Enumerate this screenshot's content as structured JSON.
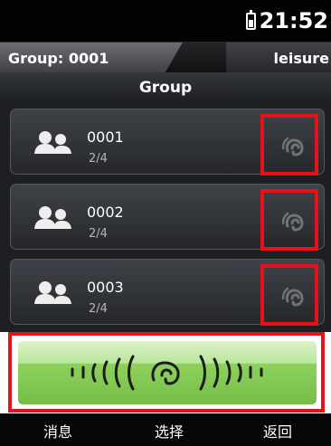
{
  "status": {
    "time": "21:52",
    "battery_icon": "battery-icon"
  },
  "header": {
    "group_label": "Group: 0001",
    "mode_label": "leisure"
  },
  "title": "Group",
  "groups": [
    {
      "name": "0001",
      "members": "2/4",
      "icon": "people-icon",
      "action_icon": "listen-ear-icon"
    },
    {
      "name": "0002",
      "members": "2/4",
      "icon": "people-icon",
      "action_icon": "listen-ear-icon"
    },
    {
      "name": "0003",
      "members": "2/4",
      "icon": "people-icon",
      "action_icon": "listen-ear-icon"
    }
  ],
  "ptt": {
    "icon": "push-to-talk-ear-icon",
    "color": "#7fc44c"
  },
  "footer": {
    "left": "消息",
    "center": "选择",
    "right": "返回"
  },
  "highlight_color": "#e8111a"
}
